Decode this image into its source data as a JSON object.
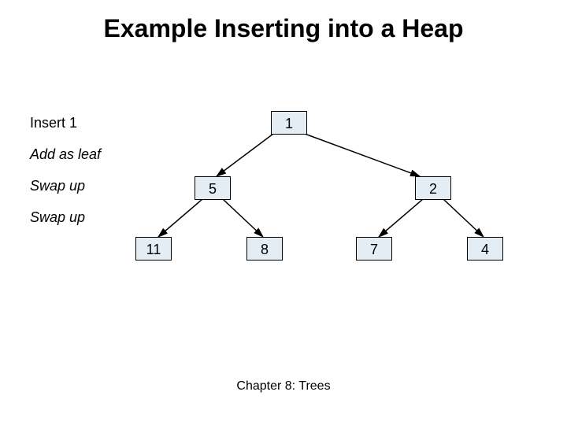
{
  "title": "Example Inserting into a Heap",
  "steps": [
    "Insert 1",
    "Add as leaf",
    "Swap up",
    "Swap up"
  ],
  "caption": "Chapter 8: Trees",
  "tree": {
    "root": "1",
    "left": "5",
    "right": "2",
    "ll": "11",
    "lr": "8",
    "rl": "7",
    "rr": "4"
  }
}
